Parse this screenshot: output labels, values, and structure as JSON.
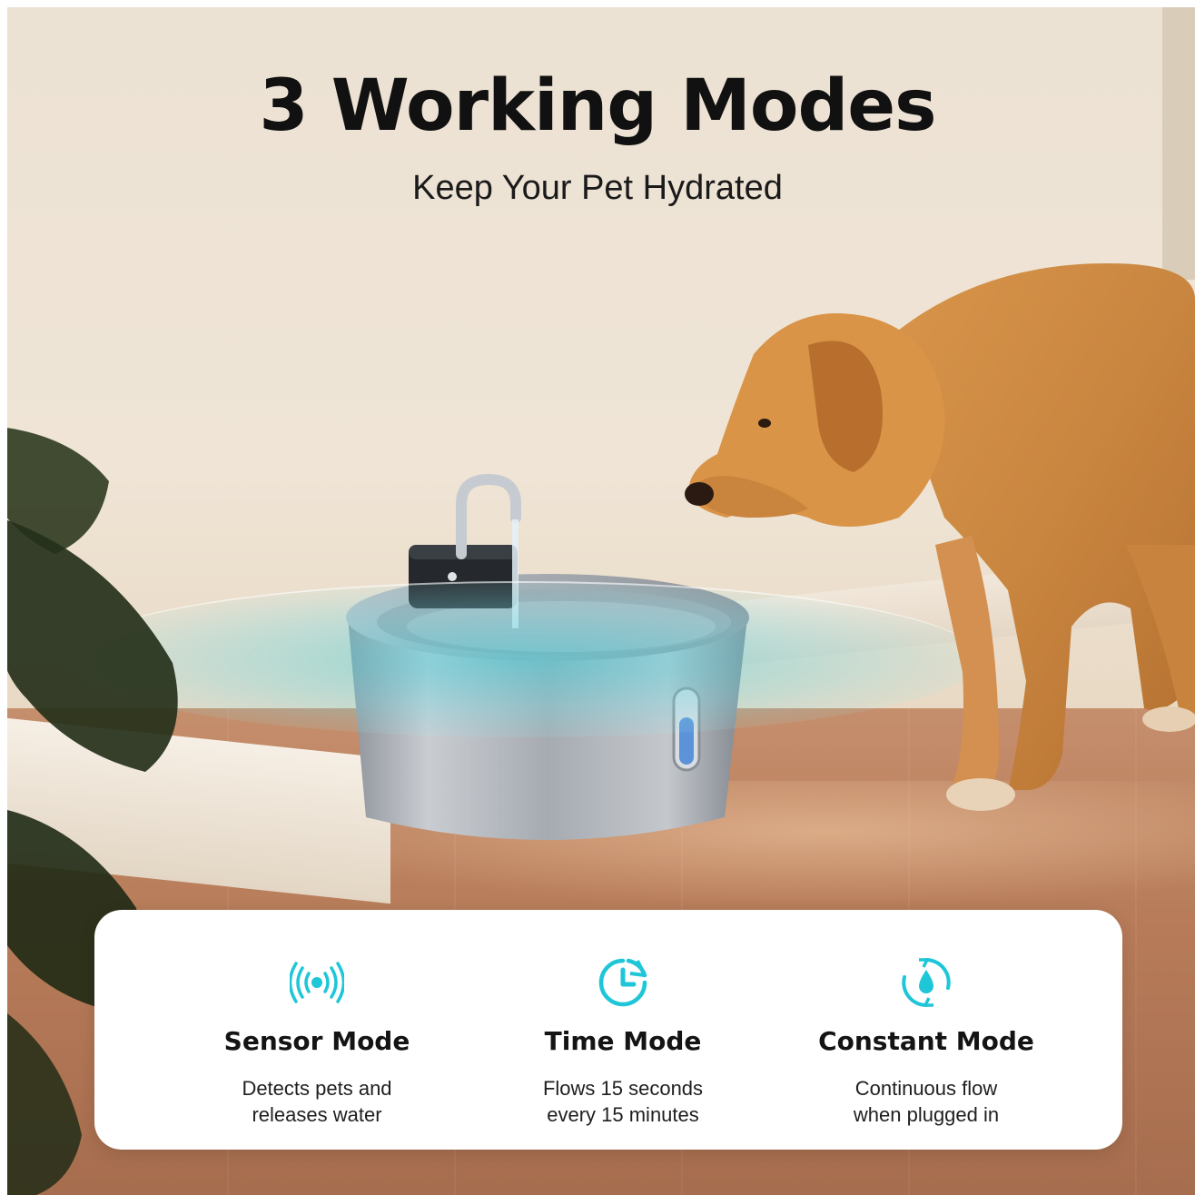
{
  "headline": {
    "title": "3 Working Modes",
    "subtitle": "Keep Your Pet Hydrated"
  },
  "accent_color": "#1ec6d8",
  "modes": [
    {
      "icon": "sensor-waves-icon",
      "title": "Sensor Mode",
      "desc_line1": "Detects pets and",
      "desc_line2": "releases water"
    },
    {
      "icon": "timer-cycle-icon",
      "title": "Time Mode",
      "desc_line1": "Flows 15 seconds",
      "desc_line2": "every 15 minutes"
    },
    {
      "icon": "water-drop-cycle-icon",
      "title": "Constant Mode",
      "desc_line1": "Continuous flow",
      "desc_line2": "when plugged in"
    }
  ]
}
